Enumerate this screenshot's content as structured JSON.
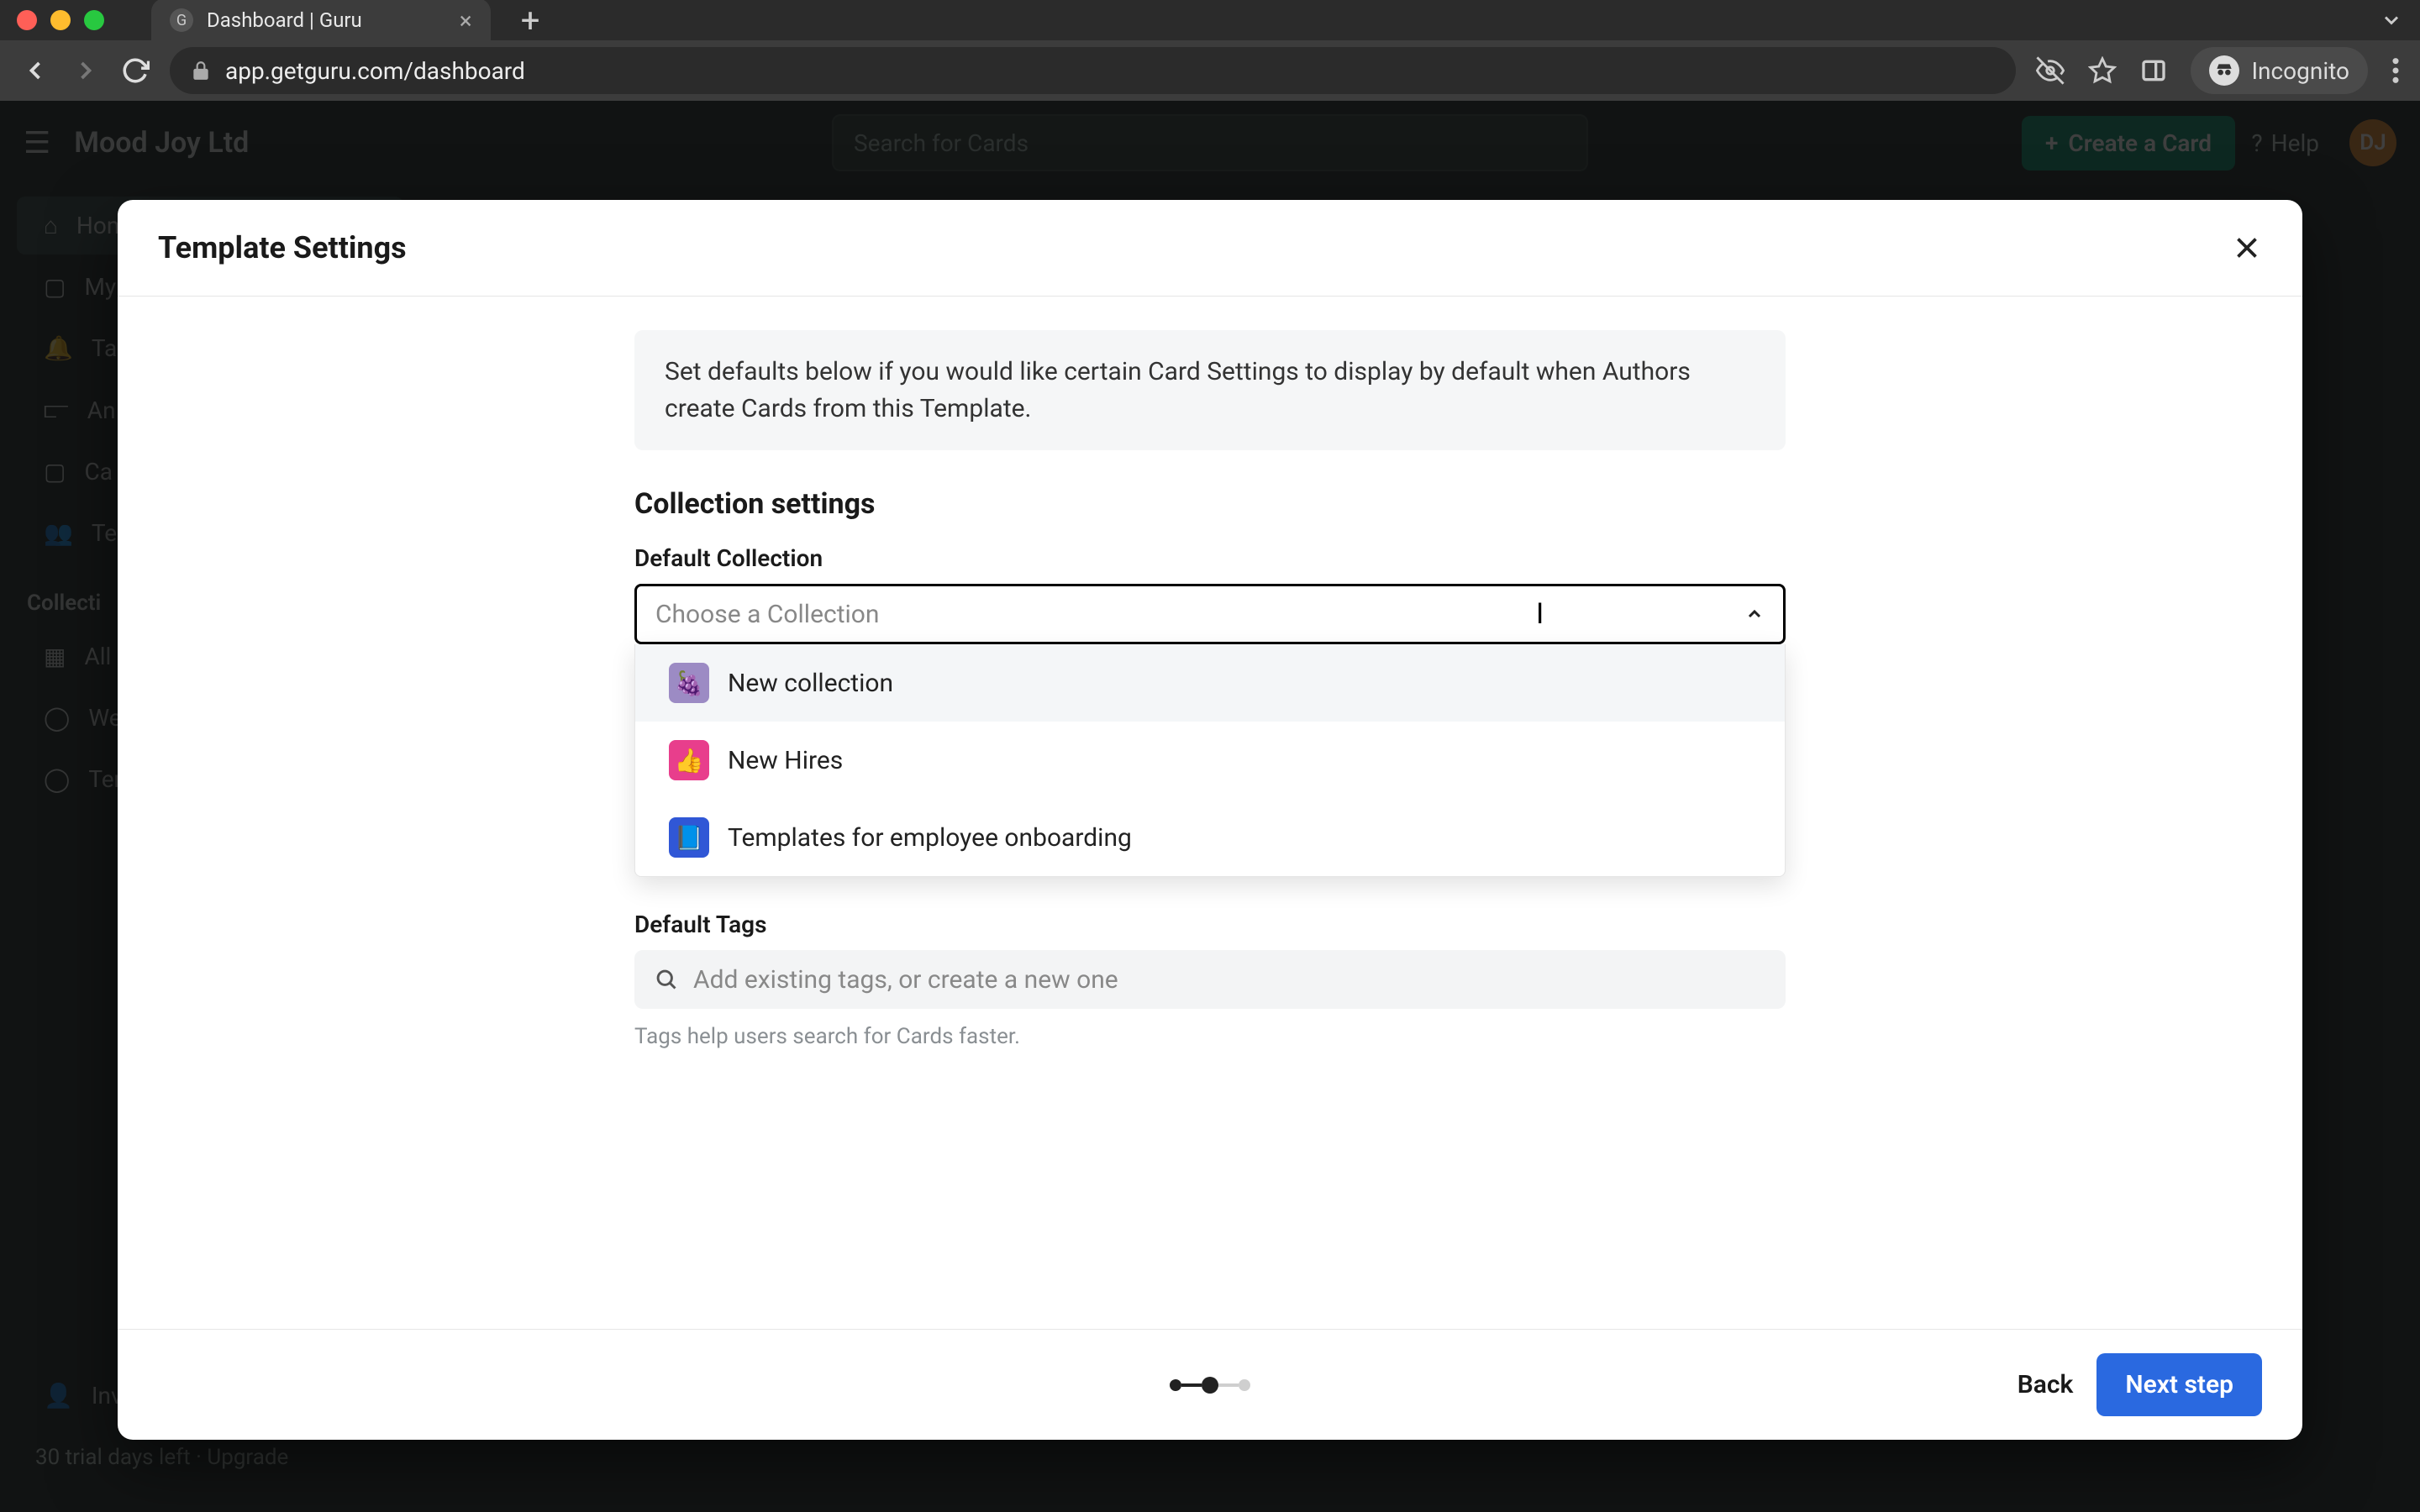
{
  "browser": {
    "tab_title": "Dashboard | Guru",
    "url": "app.getguru.com/dashboard",
    "incognito_label": "Incognito"
  },
  "app": {
    "brand": "Mood Joy Ltd",
    "search_placeholder": "Search for Cards",
    "create_card": "Create a Card",
    "help": "Help",
    "avatar": "DJ",
    "sidebar": {
      "items": [
        {
          "label": "Home"
        },
        {
          "label": "My"
        },
        {
          "label": "Tas"
        },
        {
          "label": "An"
        },
        {
          "label": "Ca"
        },
        {
          "label": "Tea"
        }
      ],
      "section": "Collecti",
      "coll_items": [
        {
          "label": "All"
        },
        {
          "label": "We"
        },
        {
          "label": "Tem"
        }
      ],
      "invite": "Inv",
      "trial": "30 trial days left · Upgrade"
    }
  },
  "modal": {
    "title": "Template Settings",
    "info": "Set defaults below if you would like certain Card Settings to display by default when Authors create Cards from this Template.",
    "section": "Collection settings",
    "field_label": "Default Collection",
    "combo_placeholder": "Choose a Collection",
    "options": [
      {
        "label": "New collection",
        "emoji": "🍇"
      },
      {
        "label": "New Hires",
        "emoji": "👍"
      },
      {
        "label": "Templates for employee onboarding",
        "emoji": "📘"
      }
    ],
    "tags_label": "Default Tags",
    "tags_placeholder": "Add existing tags, or create a new one",
    "helper": "Tags help users search for Cards faster.",
    "back": "Back",
    "next": "Next step"
  }
}
